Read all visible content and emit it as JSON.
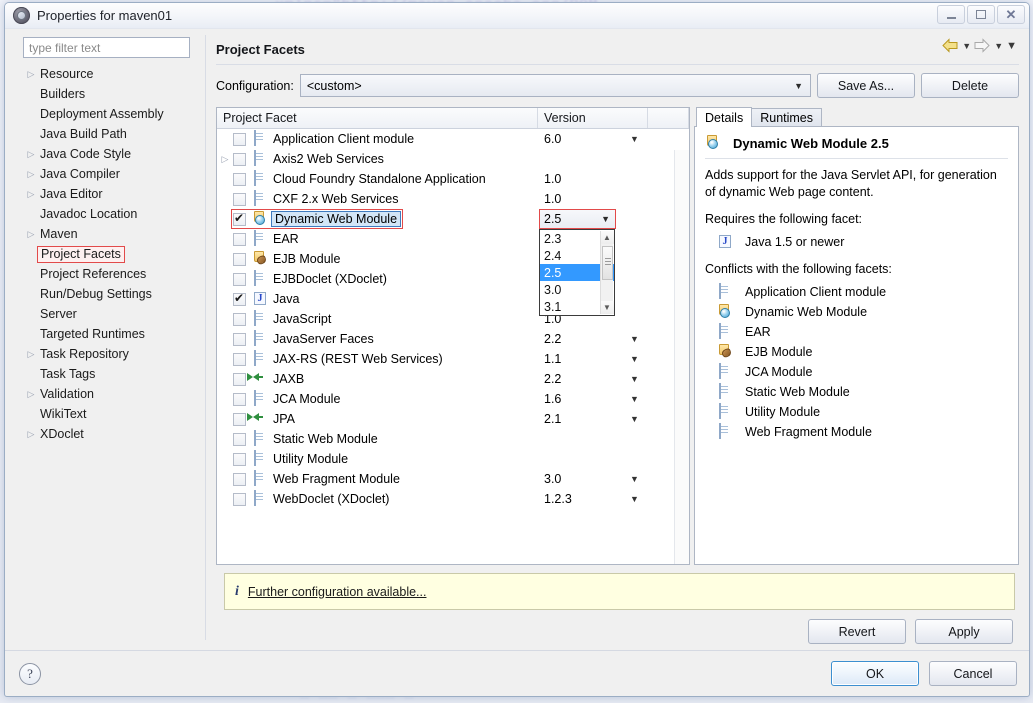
{
  "window": {
    "title": "Properties for maven01",
    "icon": "properties-icon",
    "controls": {
      "minimize": "–",
      "maximize": "▣",
      "close": "✕"
    }
  },
  "sidebar": {
    "filter_placeholder": "type filter text",
    "filter_value": "",
    "items": [
      {
        "label": "Resource",
        "expandable": true,
        "selected": false
      },
      {
        "label": "Builders",
        "expandable": false,
        "selected": false
      },
      {
        "label": "Deployment Assembly",
        "expandable": false,
        "selected": false
      },
      {
        "label": "Java Build Path",
        "expandable": false,
        "selected": false
      },
      {
        "label": "Java Code Style",
        "expandable": true,
        "selected": false
      },
      {
        "label": "Java Compiler",
        "expandable": true,
        "selected": false
      },
      {
        "label": "Java Editor",
        "expandable": true,
        "selected": false
      },
      {
        "label": "Javadoc Location",
        "expandable": false,
        "selected": false
      },
      {
        "label": "Maven",
        "expandable": true,
        "selected": false
      },
      {
        "label": "Project Facets",
        "expandable": false,
        "selected": true
      },
      {
        "label": "Project References",
        "expandable": false,
        "selected": false
      },
      {
        "label": "Run/Debug Settings",
        "expandable": false,
        "selected": false
      },
      {
        "label": "Server",
        "expandable": false,
        "selected": false
      },
      {
        "label": "Targeted Runtimes",
        "expandable": false,
        "selected": false
      },
      {
        "label": "Task Repository",
        "expandable": true,
        "selected": false
      },
      {
        "label": "Task Tags",
        "expandable": false,
        "selected": false
      },
      {
        "label": "Validation",
        "expandable": true,
        "selected": false
      },
      {
        "label": "WikiText",
        "expandable": false,
        "selected": false
      },
      {
        "label": "XDoclet",
        "expandable": true,
        "selected": false
      }
    ]
  },
  "page": {
    "title": "Project Facets",
    "nav": {
      "back_icon": "back-arrow-icon",
      "back_menu_icon": "chevron-down-icon",
      "forward_icon": "forward-arrow-icon",
      "forward_menu_icon": "chevron-down-icon",
      "menu_icon": "chevron-down-icon"
    }
  },
  "configuration": {
    "label": "Configuration:",
    "value": "<custom>",
    "dropdown_icon": "chevron-down-icon",
    "save_as_label": "Save As...",
    "delete_label": "Delete"
  },
  "facet_table": {
    "columns": [
      "Project Facet",
      "Version"
    ],
    "rows": [
      {
        "name": "Application Client module",
        "version": "6.0",
        "checked": false,
        "icon": "doc-icon",
        "has_caret": true,
        "expandable": false
      },
      {
        "name": "Axis2 Web Services",
        "version": "",
        "checked": false,
        "icon": "doc-icon",
        "has_caret": false,
        "expandable": true
      },
      {
        "name": "Cloud Foundry Standalone Application",
        "version": "1.0",
        "checked": false,
        "icon": "doc-icon",
        "has_caret": false,
        "expandable": false
      },
      {
        "name": "CXF 2.x Web Services",
        "version": "1.0",
        "checked": false,
        "icon": "doc-icon",
        "has_caret": false,
        "expandable": false
      },
      {
        "name": "Dynamic Web Module",
        "version": "2.5",
        "checked": true,
        "icon": "web-module-icon",
        "has_caret": false,
        "expandable": false,
        "selected": true,
        "highlighted": true
      },
      {
        "name": "EAR",
        "version": "",
        "checked": false,
        "icon": "doc-icon",
        "has_caret": false,
        "expandable": false
      },
      {
        "name": "EJB Module",
        "version": "",
        "checked": false,
        "icon": "ejb-icon",
        "has_caret": false,
        "expandable": false
      },
      {
        "name": "EJBDoclet (XDoclet)",
        "version": "",
        "checked": false,
        "icon": "doc-icon",
        "has_caret": false,
        "expandable": false
      },
      {
        "name": "Java",
        "version": "",
        "checked": true,
        "icon": "java-icon",
        "has_caret": false,
        "expandable": false
      },
      {
        "name": "JavaScript",
        "version": "1.0",
        "checked": false,
        "icon": "doc-icon",
        "has_caret": false,
        "expandable": false
      },
      {
        "name": "JavaServer Faces",
        "version": "2.2",
        "checked": false,
        "icon": "doc-icon",
        "has_caret": true,
        "expandable": false
      },
      {
        "name": "JAX-RS (REST Web Services)",
        "version": "1.1",
        "checked": false,
        "icon": "doc-icon",
        "has_caret": true,
        "expandable": false
      },
      {
        "name": "JAXB",
        "version": "2.2",
        "checked": false,
        "icon": "arrows-icon",
        "has_caret": true,
        "expandable": false
      },
      {
        "name": "JCA Module",
        "version": "1.6",
        "checked": false,
        "icon": "doc-icon",
        "has_caret": true,
        "expandable": false
      },
      {
        "name": "JPA",
        "version": "2.1",
        "checked": false,
        "icon": "arrows-icon",
        "has_caret": true,
        "expandable": false
      },
      {
        "name": "Static Web Module",
        "version": "",
        "checked": false,
        "icon": "doc-icon",
        "has_caret": false,
        "expandable": false
      },
      {
        "name": "Utility Module",
        "version": "",
        "checked": false,
        "icon": "doc-icon",
        "has_caret": false,
        "expandable": false
      },
      {
        "name": "Web Fragment Module",
        "version": "3.0",
        "checked": false,
        "icon": "doc-icon",
        "has_caret": true,
        "expandable": false
      },
      {
        "name": "WebDoclet (XDoclet)",
        "version": "1.2.3",
        "checked": false,
        "icon": "doc-icon",
        "has_caret": true,
        "expandable": false
      }
    ]
  },
  "version_dropdown": {
    "open": true,
    "selected": "2.5",
    "editor_value": "2.5",
    "dropdown_icon": "chevron-down-icon",
    "options": [
      "2.3",
      "2.4",
      "2.5",
      "3.0",
      "3.1"
    ],
    "scroll_up_icon": "scroll-up-icon",
    "scroll_down_icon": "scroll-down-icon"
  },
  "details": {
    "tabs": [
      {
        "label": "Details",
        "active": true
      },
      {
        "label": "Runtimes",
        "active": false
      }
    ],
    "heading": "Dynamic Web Module 2.5",
    "heading_icon": "web-module-icon",
    "description": "Adds support for the Java Servlet API, for generation of dynamic Web page content.",
    "requires_label": "Requires the following facet:",
    "requires": [
      {
        "label": "Java 1.5 or newer",
        "icon": "java-icon"
      }
    ],
    "conflicts_label": "Conflicts with the following facets:",
    "conflicts": [
      {
        "label": "Application Client module",
        "icon": "doc-icon"
      },
      {
        "label": "Dynamic Web Module",
        "icon": "web-module-icon"
      },
      {
        "label": "EAR",
        "icon": "doc-icon"
      },
      {
        "label": "EJB Module",
        "icon": "ejb-icon"
      },
      {
        "label": "JCA Module",
        "icon": "doc-icon"
      },
      {
        "label": "Static Web Module",
        "icon": "doc-icon"
      },
      {
        "label": "Utility Module",
        "icon": "doc-icon"
      },
      {
        "label": "Web Fragment Module",
        "icon": "doc-icon"
      }
    ]
  },
  "info": {
    "icon": "info-icon",
    "link": "Further configuration available..."
  },
  "actions": {
    "revert_label": "Revert",
    "apply_label": "Apply"
  },
  "footer": {
    "help_label": "?",
    "ok_label": "OK",
    "cancel_label": "Cancel"
  },
  "bleed": {
    "top": "xmlns=\"http://maven.apache.org/POM",
    "bottom": "— ——  — ——— —"
  },
  "colors": {
    "accent_red": "#e24a4a",
    "select_blue": "#3399ff",
    "info_bg": "#ffffe1",
    "primary_border": "#3c8fd0"
  }
}
